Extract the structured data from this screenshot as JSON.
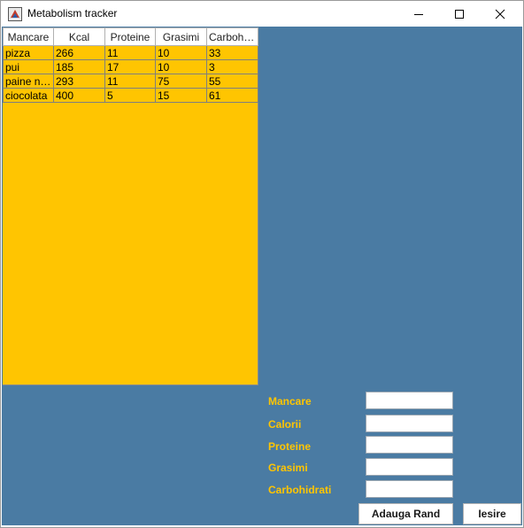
{
  "window": {
    "title": "Metabolism tracker"
  },
  "table": {
    "headers": [
      "Mancare",
      "Kcal",
      "Proteine",
      "Grasimi",
      "Carbohid..."
    ],
    "rows": [
      [
        "pizza",
        "266",
        "11",
        "10",
        "33"
      ],
      [
        "pui",
        "185",
        "17",
        "10",
        "3"
      ],
      [
        "paine ne...",
        "293",
        "11",
        "75",
        "55"
      ],
      [
        "ciocolata",
        "400",
        "5",
        "15",
        "61"
      ]
    ]
  },
  "form": {
    "labels": [
      "Mancare",
      "Calorii",
      "Proteine",
      "Grasimi",
      "Carbohidrati"
    ],
    "values": [
      "",
      "",
      "",
      "",
      ""
    ]
  },
  "buttons": {
    "add_label": "Adauga Rand",
    "exit_label": "Iesire"
  },
  "colors": {
    "panel": "#4a7ba3",
    "table_bg": "#ffc501",
    "label": "#ffc501"
  },
  "icons": {
    "app": "java-app-icon",
    "minimize": "minimize-icon",
    "maximize": "maximize-icon",
    "close": "close-icon"
  }
}
